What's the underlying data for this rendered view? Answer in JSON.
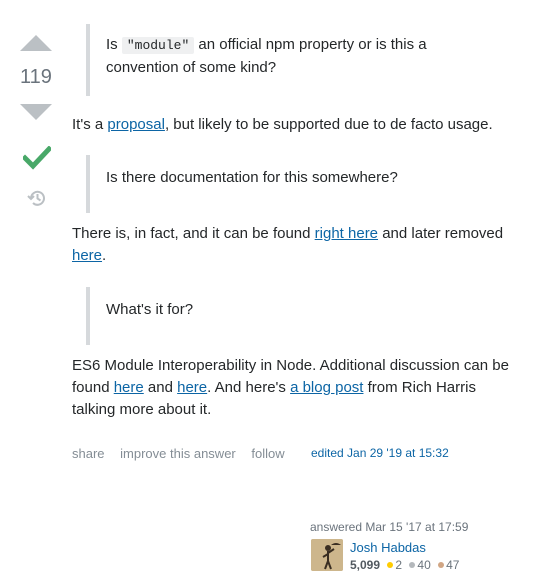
{
  "vote": {
    "count": "119"
  },
  "post": {
    "q1_part1": "Is ",
    "q1_code": "\"module\"",
    "q1_part2": " an official npm property or is this a convention of some kind?",
    "a1_part1": "It's a ",
    "a1_link": "proposal",
    "a1_part2": ", but likely to be supported due to de facto usage.",
    "q2": "Is there documentation for this somewhere?",
    "a2_part1": "There is, in fact, and it can be found ",
    "a2_link1": "right here",
    "a2_part2": " and later removed ",
    "a2_link2": "here",
    "a2_part3": ".",
    "q3": "What's it for?",
    "a3_part1": "ES6 Module Interoperability in Node. Additional discussion can be found ",
    "a3_link1": "here",
    "a3_part2": " and ",
    "a3_link2": "here",
    "a3_part3": ". And here's ",
    "a3_link3": "a blog post",
    "a3_part4": " from Rich Harris talking more about it."
  },
  "menu": {
    "share": "share",
    "improve": "improve this answer",
    "follow": "follow",
    "edited": "edited Jan 29 '19 at 15:32"
  },
  "user": {
    "answered": "answered Mar 15 '17 at 17:59",
    "name": "Josh Habdas",
    "rep": "5,099",
    "gold": "2",
    "silver": "40",
    "bronze": "47"
  },
  "colors": {
    "gold": "#ffcc01",
    "silver": "#b4b8bc",
    "bronze": "#d1a684",
    "accepted": "#48a868"
  }
}
